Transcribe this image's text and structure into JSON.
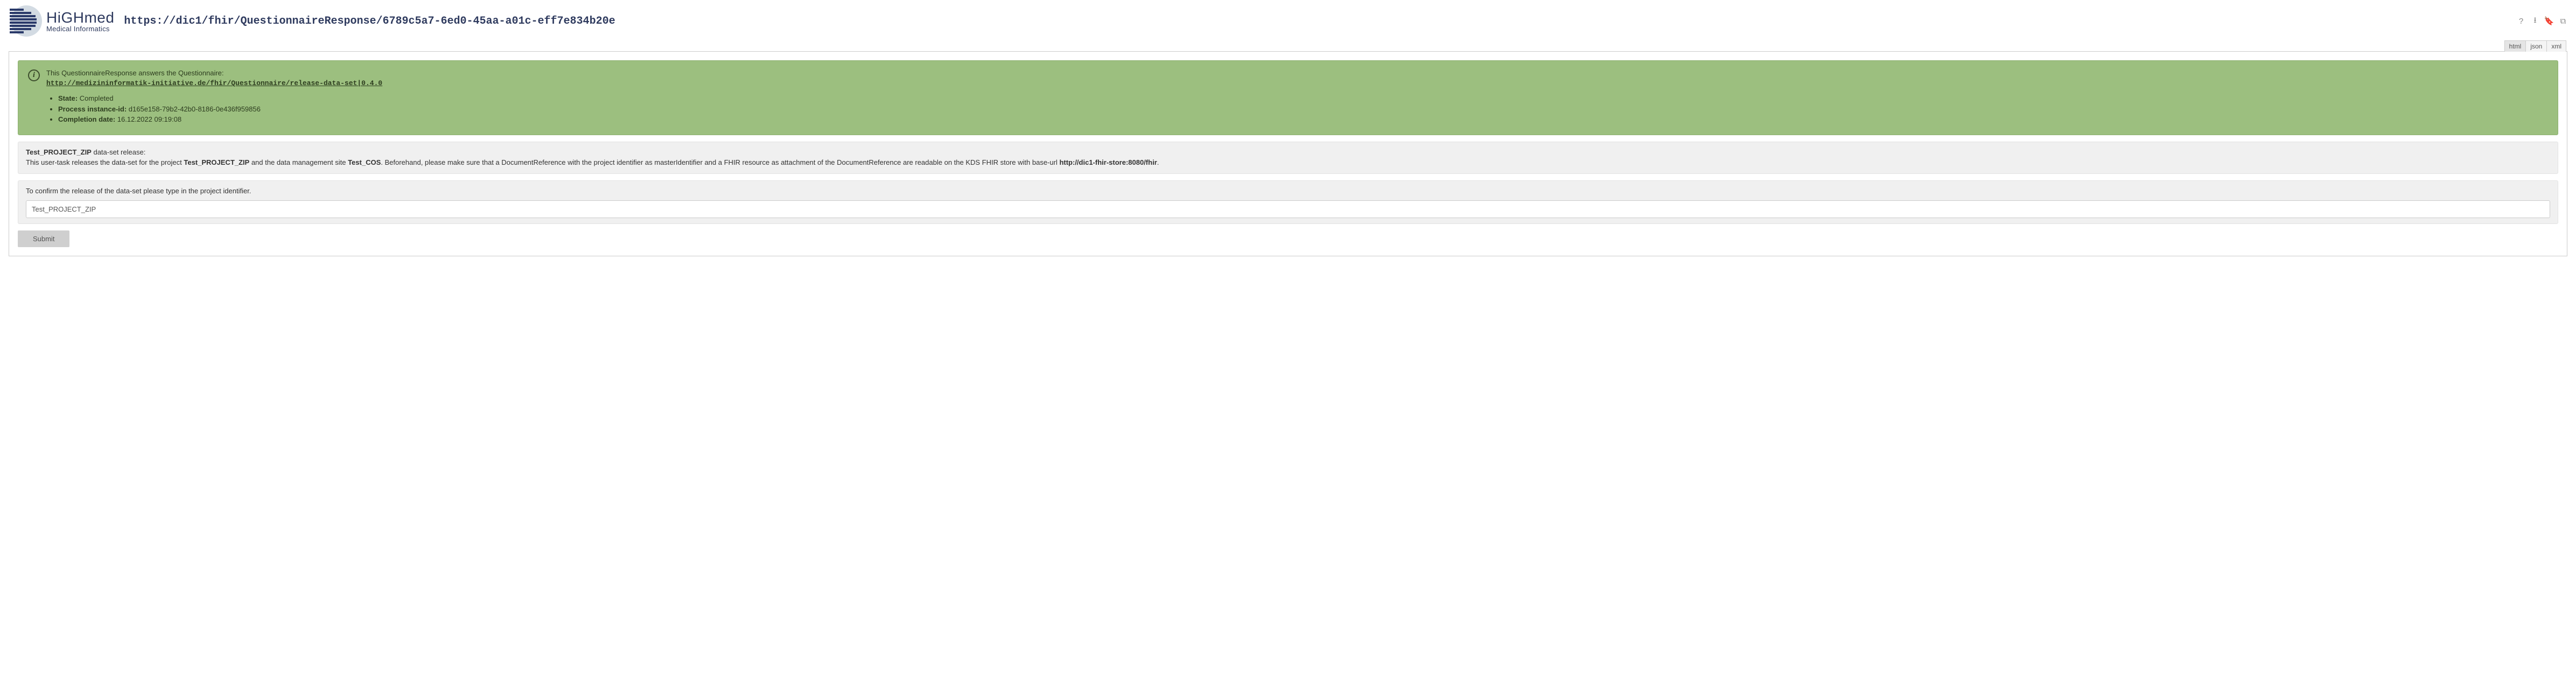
{
  "logo": {
    "title": "HiGHmed",
    "subtitle": "Medical Informatics"
  },
  "page_url": "https://dic1/fhir/QuestionnaireResponse/6789c5a7-6ed0-45aa-a01c-eff7e834b20e",
  "toolbar": {
    "help": "?",
    "download": "⭳",
    "bookmark": "🔖",
    "copy": "⧉"
  },
  "tabs": {
    "html": "html",
    "json": "json",
    "xml": "xml"
  },
  "info": {
    "lead": "This QuestionnaireResponse answers the Questionnaire:",
    "link": "http://medizininformatik-initiative.de/fhir/Questionnaire/release-data-set|0.4.0",
    "state_label": "State:",
    "state_value": "Completed",
    "process_label": "Process instance-id:",
    "process_value": "d165e158-79b2-42b0-8186-0e436f959856",
    "completion_label": "Completion date:",
    "completion_value": "16.12.2022 09:19:08"
  },
  "description": {
    "project_name": "Test_PROJECT_ZIP",
    "title_suffix": " data-set release:",
    "line_pre": "This user-task releases the data-set for the project ",
    "line_mid1": " and the data management site ",
    "site_name": "Test_COS",
    "line_mid2": ". Beforehand, please make sure that a DocumentReference with the project identifier as masterIdentifier and a FHIR resource as attachment of the DocumentReference are readable on the KDS FHIR store with base-url ",
    "base_url": "http://dic1-fhir-store:8080/fhir",
    "line_end": "."
  },
  "confirm": {
    "label": "To confirm the release of the data-set please type in the project identifier.",
    "value": "Test_PROJECT_ZIP"
  },
  "submit_label": "Submit"
}
